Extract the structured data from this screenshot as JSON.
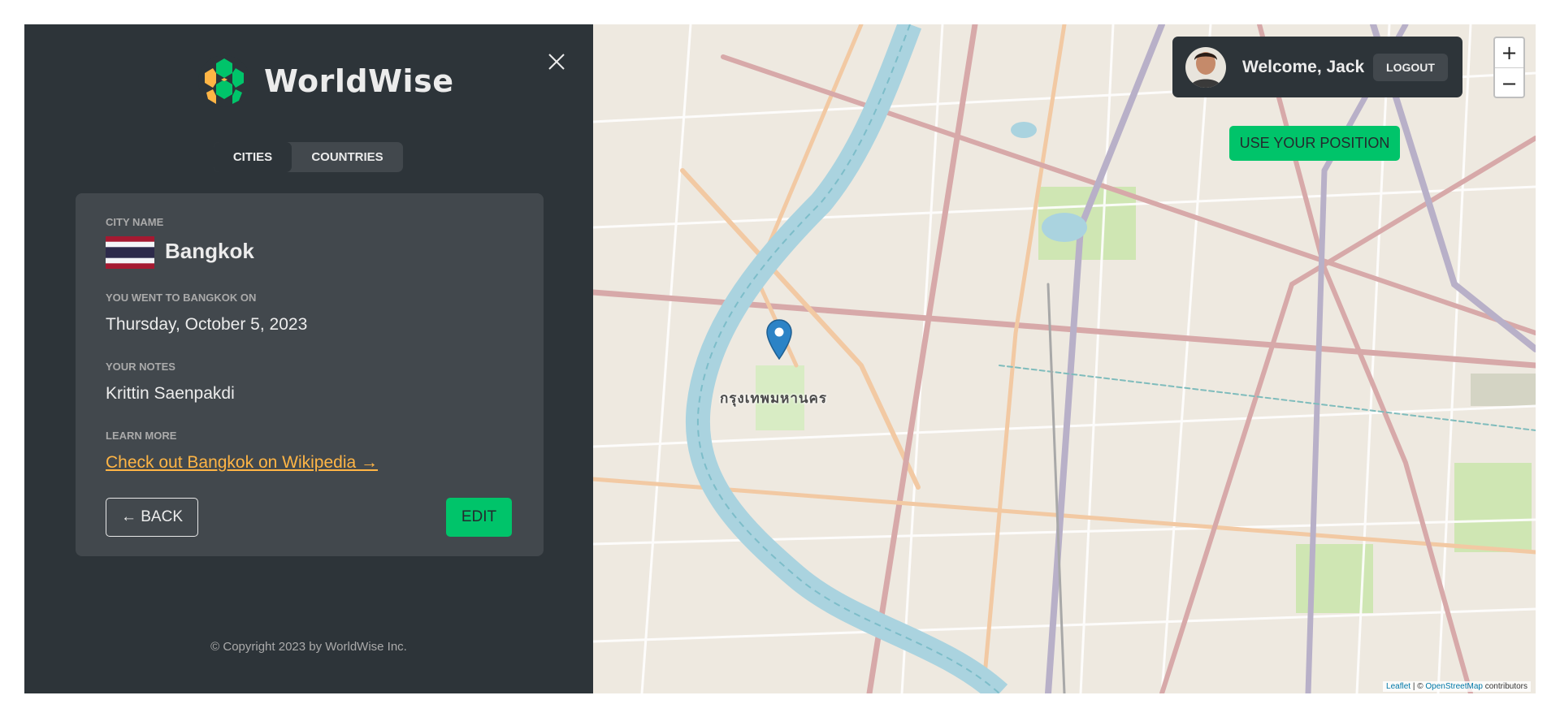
{
  "sidebar": {
    "app_name": "WorldWise",
    "tabs": [
      {
        "label": "CITIES",
        "active": true
      },
      {
        "label": "COUNTRIES",
        "active": false
      }
    ],
    "city": {
      "name_label": "CITY NAME",
      "flag": "Thailand flag",
      "name": "Bangkok",
      "went_label": "YOU WENT TO BANGKOK ON",
      "date": "Thursday, October 5, 2023",
      "notes_label": "YOUR NOTES",
      "notes": "Krittin Saenpakdi",
      "learn_label": "LEARN MORE",
      "wiki_link": "Check out Bangkok on Wikipedia →"
    },
    "back_label": "← BACK",
    "edit_label": "EDIT",
    "copyright": "© Copyright 2023 by WorldWise Inc."
  },
  "map": {
    "welcome": "Welcome, Jack",
    "logout_label": "LOGOUT",
    "position_label": "USE YOUR POSITION",
    "zoom_in": "+",
    "zoom_out": "−",
    "city_label": "กรุงเทพมหานคร",
    "attribution": {
      "leaflet": "Leaflet",
      "sep": " | © ",
      "osm": "OpenStreetMap",
      "contributors": " contributors"
    }
  },
  "colors": {
    "sidebar_bg": "#2d3439",
    "card_bg": "#42484d",
    "accent_green": "#00c46a",
    "link_orange": "#ffb545",
    "river": "#aad3df"
  }
}
